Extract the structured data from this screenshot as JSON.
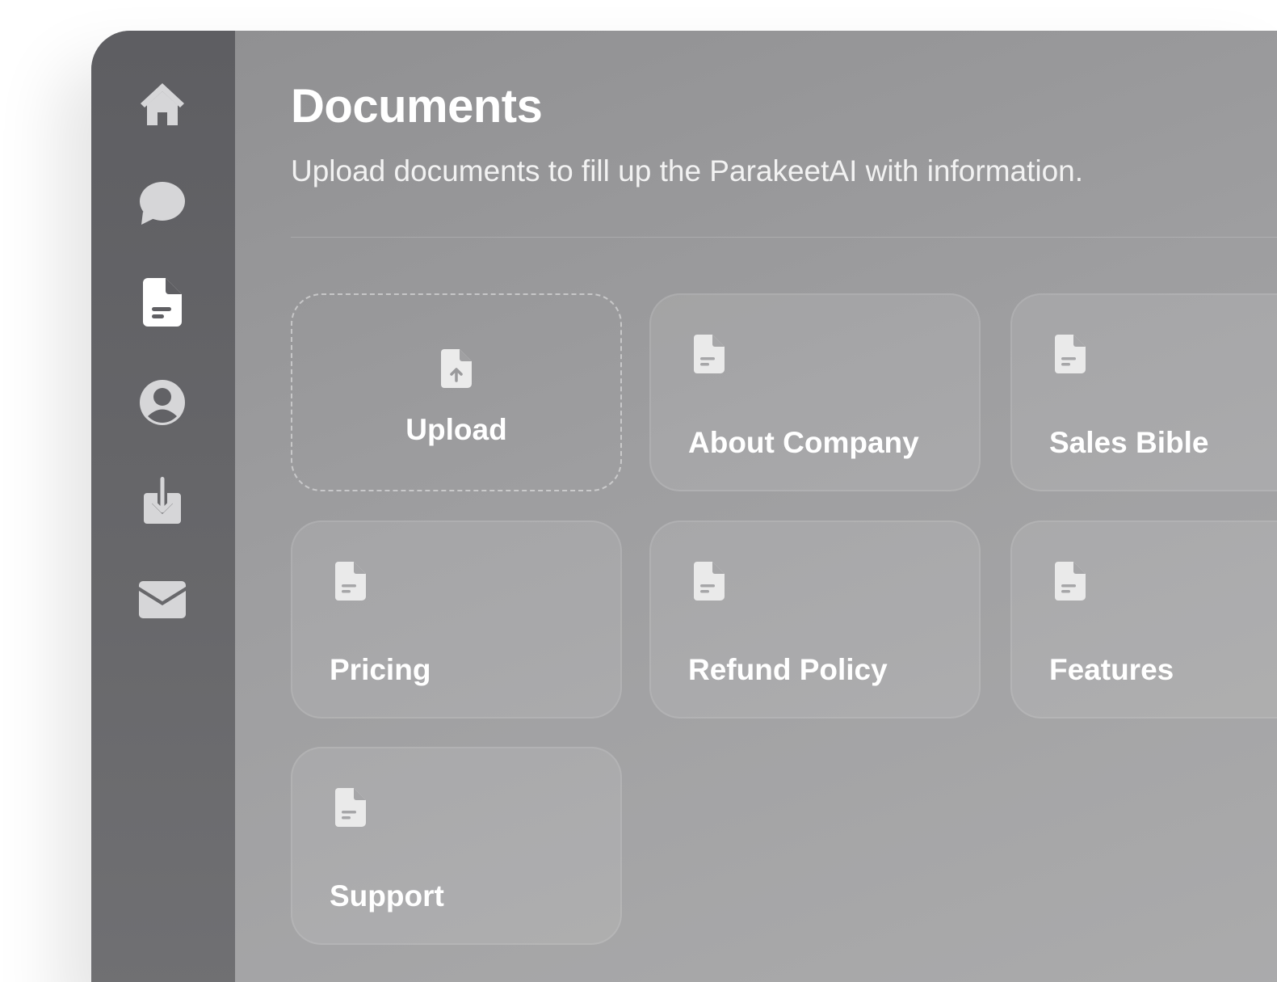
{
  "sidebar": {
    "items": [
      {
        "name": "home",
        "icon": "home-icon"
      },
      {
        "name": "chat",
        "icon": "chat-bubble-icon"
      },
      {
        "name": "documents",
        "icon": "document-icon",
        "active": true
      },
      {
        "name": "profile",
        "icon": "user-icon"
      },
      {
        "name": "downloads",
        "icon": "download-icon"
      },
      {
        "name": "mail",
        "icon": "mail-icon"
      }
    ]
  },
  "header": {
    "title": "Documents",
    "subtitle": "Upload documents to fill up the ParakeetAI with information."
  },
  "cards": [
    {
      "label": "Upload",
      "icon": "file-upload-icon",
      "type": "upload"
    },
    {
      "label": "About Company",
      "icon": "document-icon"
    },
    {
      "label": "Sales Bible",
      "icon": "document-icon"
    },
    {
      "label": "Pricing",
      "icon": "document-icon"
    },
    {
      "label": "Refund Policy",
      "icon": "document-icon"
    },
    {
      "label": "Features",
      "icon": "document-icon"
    },
    {
      "label": "Support",
      "icon": "document-icon"
    }
  ],
  "colors": {
    "sidebar": "#646467",
    "content": "#9e9ea0",
    "text": "#ffffff",
    "icon_inactive": "#d8d8d8"
  }
}
